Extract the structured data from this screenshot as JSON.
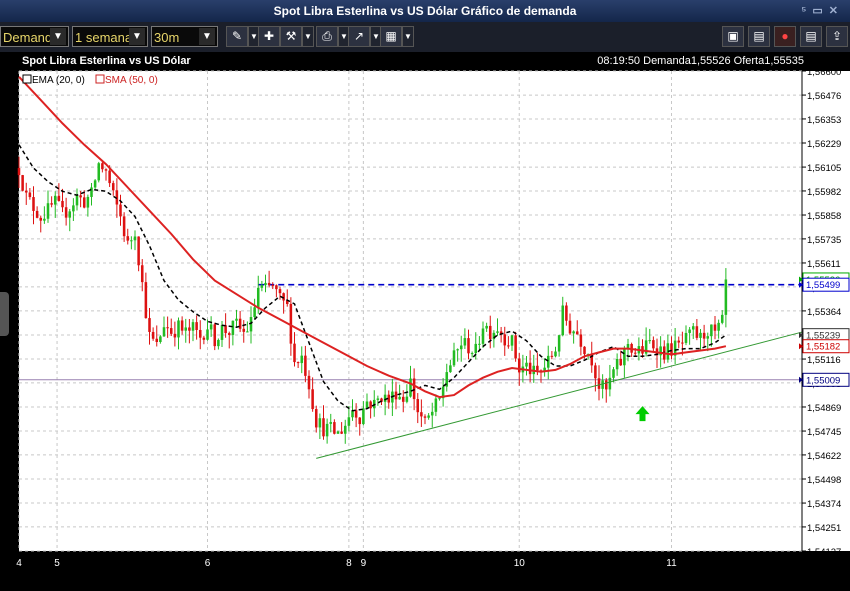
{
  "window": {
    "title": "Spot Libra Esterlina vs US Dólar Gráfico de demanda"
  },
  "toolbar": {
    "price_type": "Demanda",
    "period": "1 semana",
    "interval": "30m",
    "icons": [
      "pencil-icon",
      "pin-icon",
      "tools-icon",
      "print-icon",
      "trend-icon",
      "grid-icon",
      "layout-icon",
      "chart-icon",
      "alert-icon",
      "document-icon",
      "export-icon"
    ]
  },
  "header": {
    "instrument": "Spot Libra Esterlina vs US Dólar",
    "time": "08:19:50",
    "bid": "Demanda1,55526",
    "ask": "Oferta1,55535"
  },
  "legend": [
    {
      "label": "EMA (20, 0)",
      "color": "#000000"
    },
    {
      "label": "SMA (50, 0)",
      "color": "#cc2222"
    }
  ],
  "chart_data": {
    "type": "candlestick",
    "y_ticks": [
      "1,56600",
      "1,56476",
      "1,56353",
      "1,56229",
      "1,56105",
      "1,55982",
      "1,55858",
      "1,55735",
      "1,55611",
      "1,55488",
      "1,55364",
      "1,55240",
      "1,55116",
      "1,54993",
      "1,54869",
      "1,54745",
      "1,54622",
      "1,54498",
      "1,54374",
      "1,54251",
      "1,54127"
    ],
    "ylim": [
      1.54127,
      1.566
    ],
    "x_labels": [
      {
        "label": "4",
        "x": 0
      },
      {
        "label": "5",
        "x": 10.5
      },
      {
        "label": "6",
        "x": 52
      },
      {
        "label": "8",
        "x": 91
      },
      {
        "label": "9",
        "x": 95
      },
      {
        "label": "10",
        "x": 138
      },
      {
        "label": "11",
        "x": 180
      }
    ],
    "xlim": [
      0,
      216
    ],
    "price_labels": [
      {
        "text": "1,55526",
        "value": 1.55526,
        "color": "#00aa00"
      },
      {
        "text": "1,55499",
        "value": 1.55499,
        "color": "#0000cc"
      },
      {
        "text": "1,55239",
        "value": 1.55239,
        "color": "#333333"
      },
      {
        "text": "1,55182",
        "value": 1.55182,
        "color": "#cc0000"
      },
      {
        "text": "1,55009",
        "value": 1.55009,
        "color": "#000080"
      }
    ],
    "horizontal_lines": [
      {
        "value": 1.55499,
        "x_from": 66,
        "color": "#0000cc",
        "style": "dashed"
      },
      {
        "value": 1.55009,
        "x_from": 0,
        "color": "#9980b0",
        "style": "solid"
      }
    ],
    "trendline": {
      "x1": 82,
      "y1": 1.54604,
      "x2": 216,
      "y2": 1.55255,
      "color": "#339933"
    },
    "marker": {
      "type": "up-arrow",
      "x": 172,
      "y": 1.54832,
      "color": "#00cc00"
    },
    "ema_20": [
      [
        0,
        1.5622
      ],
      [
        4,
        1.561
      ],
      [
        8,
        1.5603
      ],
      [
        12,
        1.5598
      ],
      [
        16,
        1.5596
      ],
      [
        20,
        1.5599
      ],
      [
        24,
        1.5598
      ],
      [
        28,
        1.5593
      ],
      [
        32,
        1.5585
      ],
      [
        36,
        1.557
      ],
      [
        40,
        1.5552
      ],
      [
        44,
        1.5542
      ],
      [
        48,
        1.5536
      ],
      [
        52,
        1.5531
      ],
      [
        56,
        1.5529
      ],
      [
        60,
        1.5528
      ],
      [
        64,
        1.553
      ],
      [
        68,
        1.5538
      ],
      [
        72,
        1.5544
      ],
      [
        76,
        1.554
      ],
      [
        80,
        1.552
      ],
      [
        84,
        1.55
      ],
      [
        88,
        1.549
      ],
      [
        92,
        1.5485
      ],
      [
        96,
        1.5486
      ],
      [
        100,
        1.549
      ],
      [
        104,
        1.5493
      ],
      [
        108,
        1.5495
      ],
      [
        112,
        1.5498
      ],
      [
        116,
        1.5496
      ],
      [
        120,
        1.5502
      ],
      [
        124,
        1.551
      ],
      [
        128,
        1.5518
      ],
      [
        132,
        1.5524
      ],
      [
        136,
        1.5526
      ],
      [
        140,
        1.5521
      ],
      [
        144,
        1.5513
      ],
      [
        148,
        1.5508
      ],
      [
        152,
        1.5508
      ],
      [
        156,
        1.5511
      ],
      [
        160,
        1.5515
      ],
      [
        164,
        1.5518
      ],
      [
        168,
        1.5513
      ],
      [
        172,
        1.5513
      ],
      [
        176,
        1.5514
      ],
      [
        180,
        1.5516
      ],
      [
        184,
        1.5517
      ],
      [
        188,
        1.5517
      ],
      [
        192,
        1.552
      ],
      [
        195,
        1.5524
      ]
    ],
    "sma_50": [
      [
        0,
        1.5657
      ],
      [
        6,
        1.5645
      ],
      [
        12,
        1.5633
      ],
      [
        18,
        1.5622
      ],
      [
        24,
        1.5612
      ],
      [
        30,
        1.56
      ],
      [
        36,
        1.5588
      ],
      [
        42,
        1.5576
      ],
      [
        48,
        1.5563
      ],
      [
        54,
        1.5552
      ],
      [
        60,
        1.5545
      ],
      [
        66,
        1.5538
      ],
      [
        72,
        1.5532
      ],
      [
        78,
        1.5526
      ],
      [
        84,
        1.552
      ],
      [
        90,
        1.5514
      ],
      [
        96,
        1.5508
      ],
      [
        102,
        1.5503
      ],
      [
        108,
        1.5499
      ],
      [
        112,
        1.5495
      ],
      [
        116,
        1.5492
      ],
      [
        120,
        1.5493
      ],
      [
        124,
        1.5498
      ],
      [
        128,
        1.5502
      ],
      [
        132,
        1.5505
      ],
      [
        136,
        1.5507
      ],
      [
        140,
        1.5506
      ],
      [
        144,
        1.5505
      ],
      [
        148,
        1.5506
      ],
      [
        152,
        1.5509
      ],
      [
        156,
        1.5513
      ],
      [
        160,
        1.5515
      ],
      [
        164,
        1.5517
      ],
      [
        168,
        1.5517
      ],
      [
        172,
        1.5516
      ],
      [
        176,
        1.5515
      ],
      [
        180,
        1.5514
      ],
      [
        184,
        1.5515
      ],
      [
        188,
        1.5516
      ],
      [
        192,
        1.5517
      ],
      [
        195,
        1.55182
      ]
    ],
    "anchors": [
      [
        0,
        1.561
      ],
      [
        2,
        1.5595
      ],
      [
        4,
        1.559
      ],
      [
        6,
        1.5585
      ],
      [
        8,
        1.5588
      ],
      [
        10,
        1.5592
      ],
      [
        12,
        1.5586
      ],
      [
        14,
        1.559
      ],
      [
        16,
        1.5595
      ],
      [
        18,
        1.5593
      ],
      [
        20,
        1.5596
      ],
      [
        22,
        1.5612
      ],
      [
        24,
        1.5608
      ],
      [
        26,
        1.5595
      ],
      [
        28,
        1.5585
      ],
      [
        30,
        1.557
      ],
      [
        32,
        1.5578
      ],
      [
        34,
        1.555
      ],
      [
        36,
        1.5523
      ],
      [
        38,
        1.5518
      ],
      [
        40,
        1.553
      ],
      [
        42,
        1.5526
      ],
      [
        44,
        1.5528
      ],
      [
        46,
        1.5525
      ],
      [
        48,
        1.5527
      ],
      [
        50,
        1.5523
      ],
      [
        52,
        1.5529
      ],
      [
        54,
        1.5522
      ],
      [
        56,
        1.5527
      ],
      [
        58,
        1.5526
      ],
      [
        60,
        1.5529
      ],
      [
        62,
        1.5525
      ],
      [
        64,
        1.553
      ],
      [
        66,
        1.5548
      ],
      [
        68,
        1.5547
      ],
      [
        70,
        1.5549
      ],
      [
        72,
        1.5542
      ],
      [
        74,
        1.5538
      ],
      [
        76,
        1.551
      ],
      [
        78,
        1.5513
      ],
      [
        80,
        1.5499
      ],
      [
        82,
        1.548
      ],
      [
        84,
        1.5476
      ],
      [
        86,
        1.5475
      ],
      [
        88,
        1.5473
      ],
      [
        90,
        1.5478
      ],
      [
        92,
        1.5486
      ],
      [
        94,
        1.5482
      ],
      [
        96,
        1.549
      ],
      [
        98,
        1.5488
      ],
      [
        100,
        1.5493
      ],
      [
        102,
        1.549
      ],
      [
        104,
        1.5495
      ],
      [
        106,
        1.5491
      ],
      [
        108,
        1.55
      ],
      [
        110,
        1.5485
      ],
      [
        112,
        1.5478
      ],
      [
        114,
        1.5484
      ],
      [
        116,
        1.549
      ],
      [
        118,
        1.5506
      ],
      [
        120,
        1.5512
      ],
      [
        122,
        1.552
      ],
      [
        124,
        1.5518
      ],
      [
        126,
        1.5515
      ],
      [
        128,
        1.553
      ],
      [
        130,
        1.5526
      ],
      [
        132,
        1.5528
      ],
      [
        134,
        1.5523
      ],
      [
        136,
        1.552
      ],
      [
        138,
        1.5506
      ],
      [
        140,
        1.5508
      ],
      [
        142,
        1.5504
      ],
      [
        144,
        1.5505
      ],
      [
        146,
        1.551
      ],
      [
        148,
        1.5517
      ],
      [
        150,
        1.5535
      ],
      [
        152,
        1.5528
      ],
      [
        154,
        1.5525
      ],
      [
        156,
        1.5518
      ],
      [
        158,
        1.5512
      ],
      [
        160,
        1.5498
      ],
      [
        162,
        1.5495
      ],
      [
        164,
        1.5505
      ],
      [
        166,
        1.551
      ],
      [
        168,
        1.552
      ],
      [
        170,
        1.5515
      ],
      [
        172,
        1.5516
      ],
      [
        174,
        1.552
      ],
      [
        176,
        1.5518
      ],
      [
        178,
        1.5515
      ],
      [
        180,
        1.5517
      ],
      [
        182,
        1.5518
      ],
      [
        184,
        1.5521
      ],
      [
        186,
        1.5525
      ],
      [
        188,
        1.5522
      ],
      [
        190,
        1.5527
      ],
      [
        192,
        1.5524
      ],
      [
        194,
        1.553
      ],
      [
        195,
        1.55526
      ]
    ]
  }
}
